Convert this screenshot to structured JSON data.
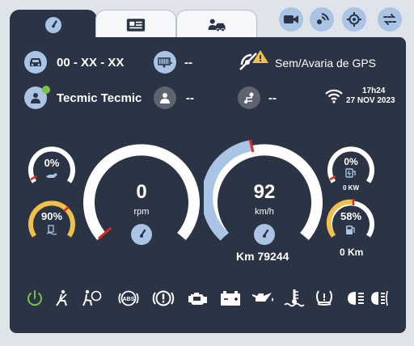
{
  "tabs": [
    {
      "name": "speedometer-icon"
    },
    {
      "name": "display-icon"
    },
    {
      "name": "driver-vehicle-icon"
    }
  ],
  "toolbar": [
    "video-icon",
    "tracking-icon",
    "target-icon",
    "routes-icon"
  ],
  "vehicle": {
    "plate": "00 - XX - XX",
    "trailer": "--"
  },
  "gps": {
    "status": "Sem/Avaria de GPS"
  },
  "driver": {
    "name": "Tecmic Tecmic",
    "codriver": "--",
    "route": "--"
  },
  "clock": {
    "time": "17h24",
    "date": "27 NOV 2023"
  },
  "gauges": {
    "rpm": {
      "value": "0",
      "unit": "rpm",
      "fill": 0.0
    },
    "speed": {
      "value": "92",
      "unit": "km/h",
      "fill": 0.55
    },
    "odometer": "Km 79244",
    "oil": {
      "value": "0%",
      "fill": 0.0
    },
    "adblue": {
      "value": "90%",
      "fill": 0.9
    },
    "electric": {
      "value": "0%",
      "sub": "0 KW",
      "fill": 0.0
    },
    "fuel": {
      "value": "58%",
      "sub": "0 Km",
      "fill": 0.58
    }
  },
  "indicators": [
    "power-icon",
    "seatbelt-icon",
    "airbag-icon",
    "abs-icon",
    "brake-warning-icon",
    "engine-icon",
    "battery-icon",
    "oil-pressure-icon",
    "coolant-temperature-icon",
    "tire-pressure-icon",
    "headlight-icon",
    "fog-light-icon"
  ],
  "colors": {
    "panel": "#2b3444",
    "accent": "#a9c4e4",
    "red": "#e0281e",
    "yellow": "#f1c04a",
    "green": "#7bc24a",
    "white": "#ffffff"
  }
}
